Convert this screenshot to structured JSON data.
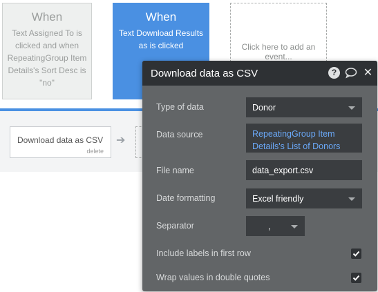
{
  "events": [
    {
      "when": "When",
      "desc": "Text Assigned To is clicked and when RepeatingGroup Item Details's Sort Desc is \"no\""
    },
    {
      "when": "When",
      "desc": "Text Download Results as is clicked"
    }
  ],
  "add_event": "Click here to add an event...",
  "action": {
    "label": "Download data as CSV",
    "delete": "delete"
  },
  "panel": {
    "title": "Download data as CSV",
    "help_glyph": "?",
    "close_glyph": "✕",
    "rows": {
      "type_of_data": {
        "label": "Type of data",
        "value": "Donor"
      },
      "data_source": {
        "label": "Data source",
        "value_line1": "RepeatingGroup Item",
        "value_line2": "Details's List of Donors"
      },
      "file_name": {
        "label": "File name",
        "value": "data_export.csv"
      },
      "date_formatting": {
        "label": "Date formatting",
        "value": "Excel friendly"
      },
      "separator": {
        "label": "Separator",
        "value": ","
      },
      "include_labels": {
        "label": "Include labels in first row",
        "checked": true
      },
      "wrap_values": {
        "label": "Wrap values in double quotes",
        "checked": true
      }
    }
  },
  "icons": {
    "help": "help-icon",
    "comment": "comment-icon",
    "close": "close-icon",
    "arrow": "arrow-right-icon",
    "check": "checkmark-icon"
  },
  "colors": {
    "accent": "#4a90e2",
    "panel_bg": "#626567",
    "panel_header": "#2e3134",
    "link": "#6aa8f7"
  }
}
